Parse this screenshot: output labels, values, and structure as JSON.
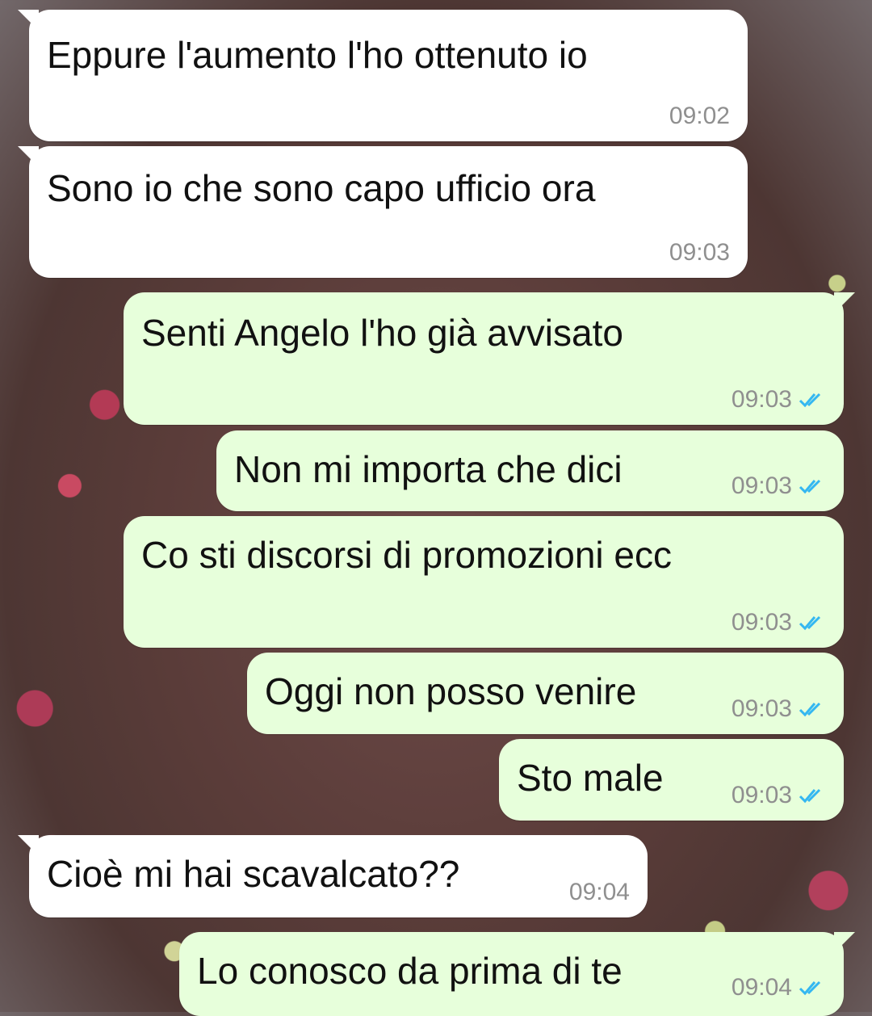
{
  "colors": {
    "incoming_bubble": "#ffffff",
    "outgoing_bubble": "#e7ffdb",
    "timestamp": "#8f8f8f",
    "read_receipt": "#34b7f1"
  },
  "messages": [
    {
      "text": "Eppure l'aumento l'ho ottenuto io",
      "time": "09:02",
      "direction": "incoming",
      "status": ""
    },
    {
      "text": "Sono io che sono capo ufficio ora",
      "time": "09:03",
      "direction": "incoming",
      "status": ""
    },
    {
      "text": "Senti Angelo l'ho già avvisato",
      "time": "09:03",
      "direction": "outgoing",
      "status": "read"
    },
    {
      "text": "Non mi importa che dici",
      "time": "09:03",
      "direction": "outgoing",
      "status": "read"
    },
    {
      "text": "Co sti discorsi di promozioni ecc",
      "time": "09:03",
      "direction": "outgoing",
      "status": "read"
    },
    {
      "text": "Oggi non posso venire",
      "time": "09:03",
      "direction": "outgoing",
      "status": "read"
    },
    {
      "text": "Sto male",
      "time": "09:03",
      "direction": "outgoing",
      "status": "read"
    },
    {
      "text": "Cioè mi hai scavalcato??",
      "time": "09:04",
      "direction": "incoming",
      "status": ""
    },
    {
      "text": "Lo conosco da prima di te",
      "time": "09:04",
      "direction": "outgoing",
      "status": "read"
    }
  ]
}
